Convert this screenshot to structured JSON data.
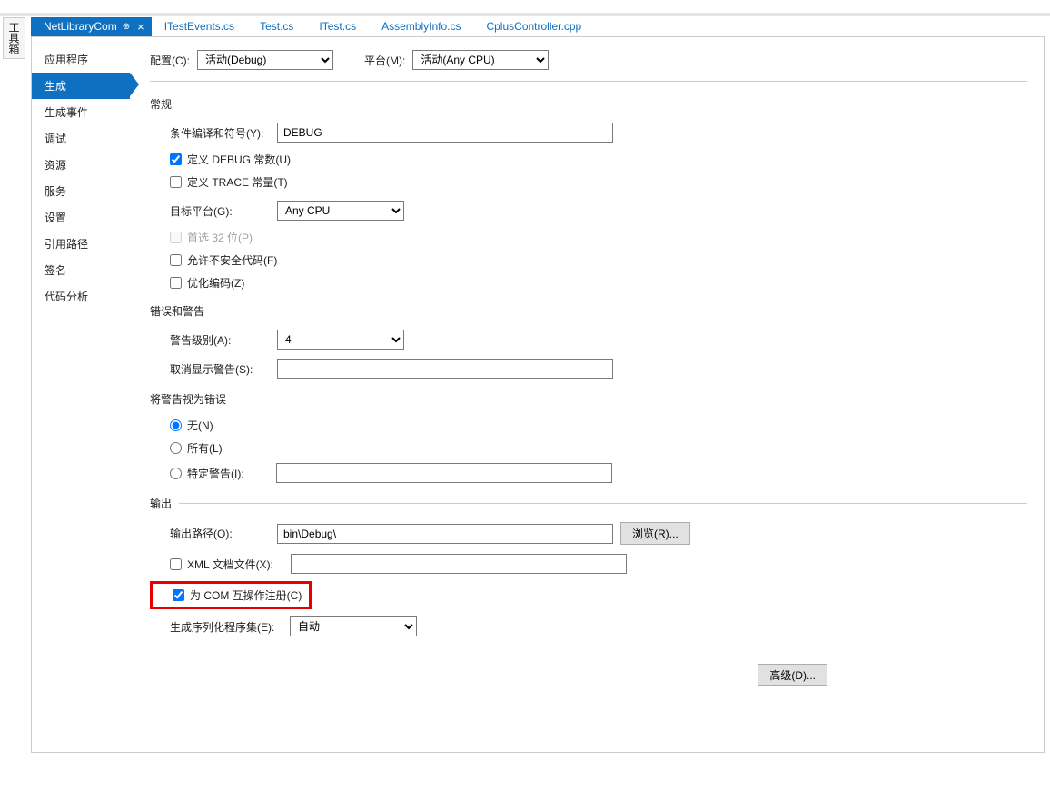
{
  "vertical_tab": "工具箱",
  "tabs": [
    {
      "label": "NetLibraryCom",
      "active": true
    },
    {
      "label": "ITestEvents.cs"
    },
    {
      "label": "Test.cs"
    },
    {
      "label": "ITest.cs"
    },
    {
      "label": "AssemblyInfo.cs"
    },
    {
      "label": "CplusController.cpp"
    }
  ],
  "sidebar": [
    "应用程序",
    "生成",
    "生成事件",
    "调试",
    "资源",
    "服务",
    "设置",
    "引用路径",
    "签名",
    "代码分析"
  ],
  "sidebar_active_index": 1,
  "top": {
    "config_label": "配置(C):",
    "config_value": "活动(Debug)",
    "platform_label": "平台(M):",
    "platform_value": "活动(Any CPU)"
  },
  "sections": {
    "general": "常规",
    "errors": "错误和警告",
    "treat_as_err": "将警告视为错误",
    "output": "输出"
  },
  "general": {
    "cond_label": "条件编译和符号(Y):",
    "cond_value": "DEBUG",
    "def_debug": "定义 DEBUG 常数(U)",
    "def_trace": "定义 TRACE 常量(T)",
    "target_label": "目标平台(G):",
    "target_value": "Any CPU",
    "prefer32": "首选 32 位(P)",
    "allow_unsafe": "允许不安全代码(F)",
    "optimize": "优化编码(Z)"
  },
  "errors": {
    "level_label": "警告级别(A):",
    "level_value": "4",
    "suppress_label": "取消显示警告(S):",
    "suppress_value": ""
  },
  "treat": {
    "none": "无(N)",
    "all": "所有(L)",
    "specific": "特定警告(I):",
    "specific_value": ""
  },
  "output": {
    "path_label": "输出路径(O):",
    "path_value": "bin\\Debug\\",
    "browse": "浏览(R)...",
    "xml_doc": "XML 文档文件(X):",
    "xml_value": "",
    "com_reg": "为 COM 互操作注册(C)",
    "serial_label": "生成序列化程序集(E):",
    "serial_value": "自动",
    "advanced": "高级(D)..."
  }
}
